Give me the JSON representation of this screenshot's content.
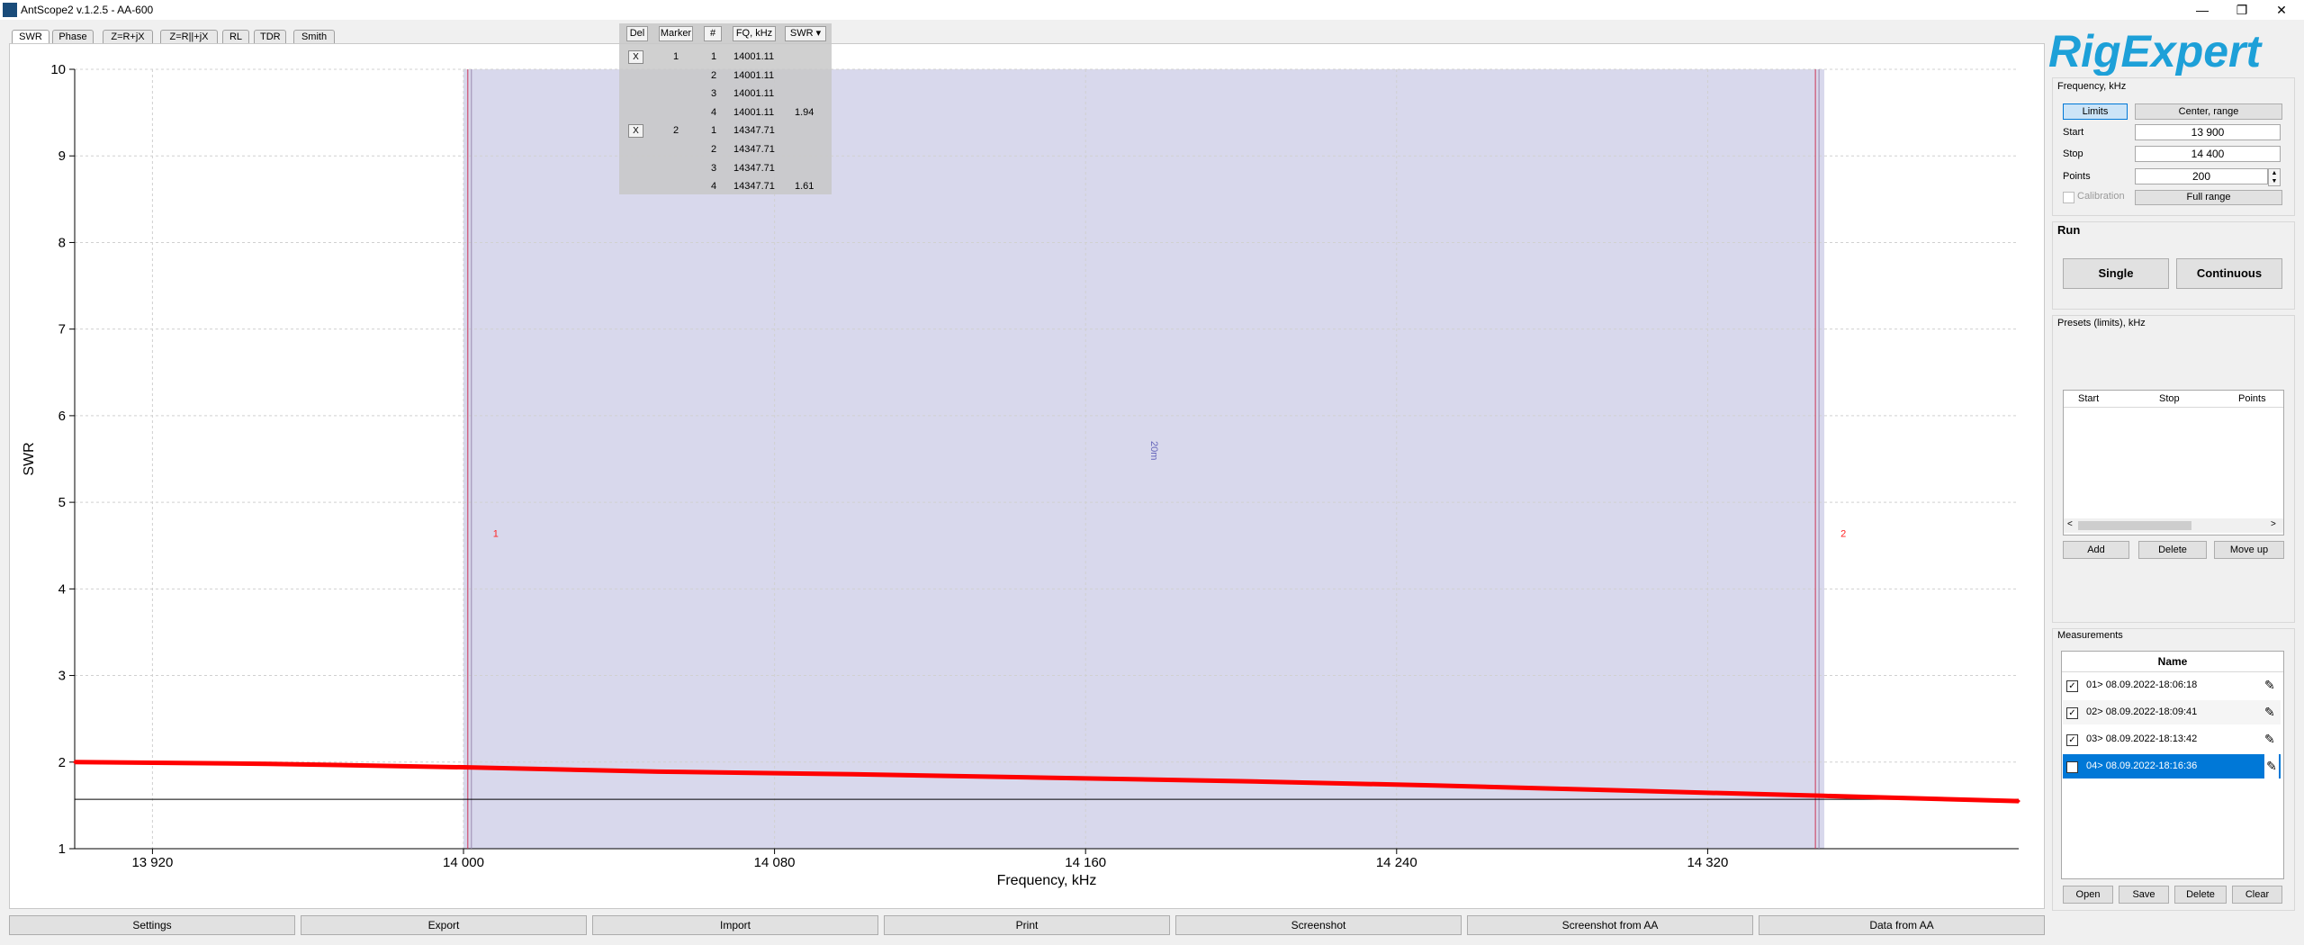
{
  "window": {
    "title": "AntScope2 v.1.2.5 - AA-600",
    "minimize": "—",
    "maximize": "❐",
    "close": "✕"
  },
  "tabs": [
    "SWR",
    "Phase",
    "Z=R+jX",
    "Z=R||+jX",
    "RL",
    "TDR",
    "Smith"
  ],
  "marker_table": {
    "headers": [
      "Del",
      "Marker",
      "#",
      "FQ, kHz",
      "SWR"
    ],
    "rows": [
      {
        "del": "X",
        "marker": "1",
        "num": "1",
        "fq": "14001.11",
        "swr": ""
      },
      {
        "del": "",
        "marker": "",
        "num": "2",
        "fq": "14001.11",
        "swr": ""
      },
      {
        "del": "",
        "marker": "",
        "num": "3",
        "fq": "14001.11",
        "swr": ""
      },
      {
        "del": "",
        "marker": "",
        "num": "4",
        "fq": "14001.11",
        "swr": "1.94"
      },
      {
        "del": "X",
        "marker": "2",
        "num": "1",
        "fq": "14347.71",
        "swr": ""
      },
      {
        "del": "",
        "marker": "",
        "num": "2",
        "fq": "14347.71",
        "swr": ""
      },
      {
        "del": "",
        "marker": "",
        "num": "3",
        "fq": "14347.71",
        "swr": ""
      },
      {
        "del": "",
        "marker": "",
        "num": "4",
        "fq": "14347.71",
        "swr": "1.61"
      }
    ]
  },
  "chart_data": {
    "type": "line",
    "xlabel": "Frequency, kHz",
    "ylabel": "SWR",
    "xlim": [
      13900,
      14400
    ],
    "ylim": [
      1,
      10
    ],
    "x_ticks": [
      13920,
      14000,
      14080,
      14160,
      14240,
      14320
    ],
    "x_tick_labels": [
      "13 920",
      "14 000",
      "14 080",
      "14 160",
      "14 240",
      "14 320"
    ],
    "y_ticks": [
      1,
      2,
      3,
      4,
      5,
      6,
      7,
      8,
      9,
      10
    ],
    "y_tick_labels": [
      "1",
      "2",
      "3",
      "4",
      "5",
      "6",
      "7",
      "8",
      "9",
      "10"
    ],
    "grid": true,
    "band": {
      "label": "20m",
      "x_start": 14000,
      "x_end": 14350,
      "color": "#d8d8ec"
    },
    "markers": [
      {
        "label": "1",
        "x": 14001.11
      },
      {
        "label": "2",
        "x": 14347.71
      }
    ],
    "reference_line": 1.57,
    "series": [
      {
        "color": "#ff0000",
        "x": [
          13900,
          13950,
          14000,
          14050,
          14100,
          14150,
          14200,
          14250,
          14300,
          14350,
          14400
        ],
        "values": [
          2.0,
          1.98,
          1.94,
          1.89,
          1.86,
          1.82,
          1.78,
          1.73,
          1.67,
          1.61,
          1.55
        ]
      }
    ]
  },
  "bottom_buttons": [
    "Settings",
    "Export",
    "Import",
    "Print",
    "Screenshot",
    "Screenshot from AA",
    "Data from AA"
  ],
  "right_panel": {
    "logo": "RigExpert",
    "frequency": {
      "title": "Frequency, kHz",
      "limits_btn": "Limits",
      "center_btn": "Center, range",
      "start_label": "Start",
      "start_value": "13 900",
      "stop_label": "Stop",
      "stop_value": "14 400",
      "points_label": "Points",
      "points_value": "200",
      "calibration_label": "Calibration",
      "full_range_btn": "Full range"
    },
    "run": {
      "title": "Run",
      "single_btn": "Single",
      "continuous_btn": "Continuous"
    },
    "presets": {
      "title": "Presets (limits), kHz",
      "columns": [
        "Start",
        "Stop",
        "Points"
      ],
      "add_btn": "Add",
      "delete_btn": "Delete",
      "moveup_btn": "Move up"
    },
    "measurements": {
      "title": "Measurements",
      "column": "Name",
      "items": [
        {
          "name": "01> 08.09.2022-18:06:18",
          "checked": true,
          "selected": false
        },
        {
          "name": "02> 08.09.2022-18:09:41",
          "checked": true,
          "selected": false
        },
        {
          "name": "03> 08.09.2022-18:13:42",
          "checked": true,
          "selected": false
        },
        {
          "name": "04> 08.09.2022-18:16:36",
          "checked": true,
          "selected": true
        }
      ],
      "open_btn": "Open",
      "save_btn": "Save",
      "delete_btn": "Delete",
      "clear_btn": "Clear"
    }
  }
}
